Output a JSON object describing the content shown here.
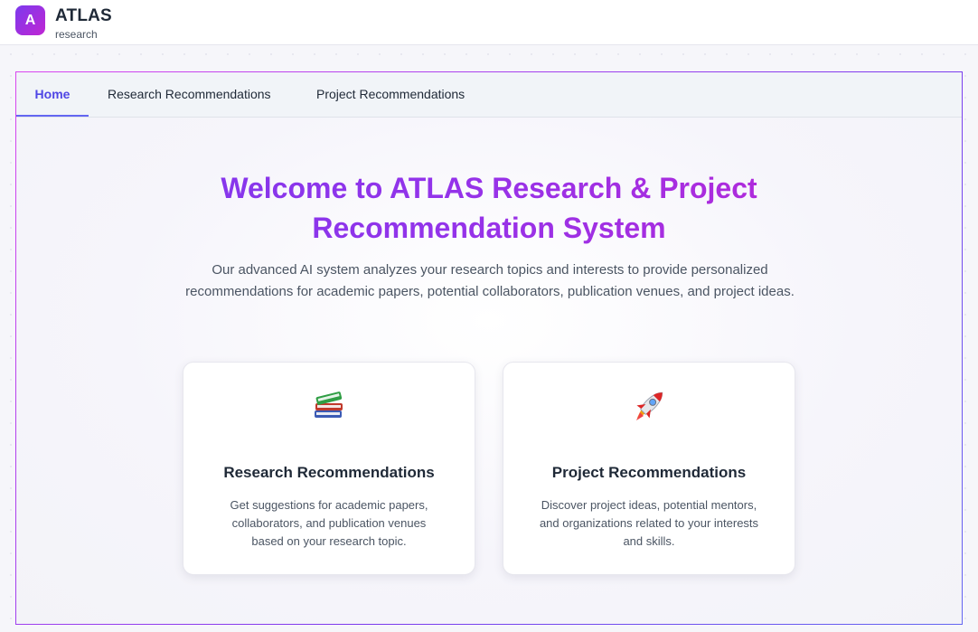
{
  "brand": {
    "logo_letter": "A",
    "title": "ATLAS",
    "subtitle": "research"
  },
  "tabs": [
    {
      "label": "Home",
      "active": true
    },
    {
      "label": "Research Recommendations",
      "active": false
    },
    {
      "label": "Project Recommendations",
      "active": false
    }
  ],
  "hero": {
    "title": "Welcome to ATLAS Research & Project Recommendation System",
    "description": "Our advanced AI system analyzes your research topics and interests to provide personalized recommendations for academic papers, potential collaborators, publication venues, and project ideas."
  },
  "cards": [
    {
      "icon": "books-icon",
      "title": "Research Recommendations",
      "description": "Get suggestions for academic papers, collaborators, and publication venues based on your research topic."
    },
    {
      "icon": "rocket-icon",
      "title": "Project Recommendations",
      "description": "Discover project ideas, potential mentors, and organizations related to your interests and skills."
    }
  ],
  "colors": {
    "accent": "#4f46e5",
    "brand_gradient_start": "#7c3aed",
    "brand_gradient_end": "#c026d3"
  }
}
